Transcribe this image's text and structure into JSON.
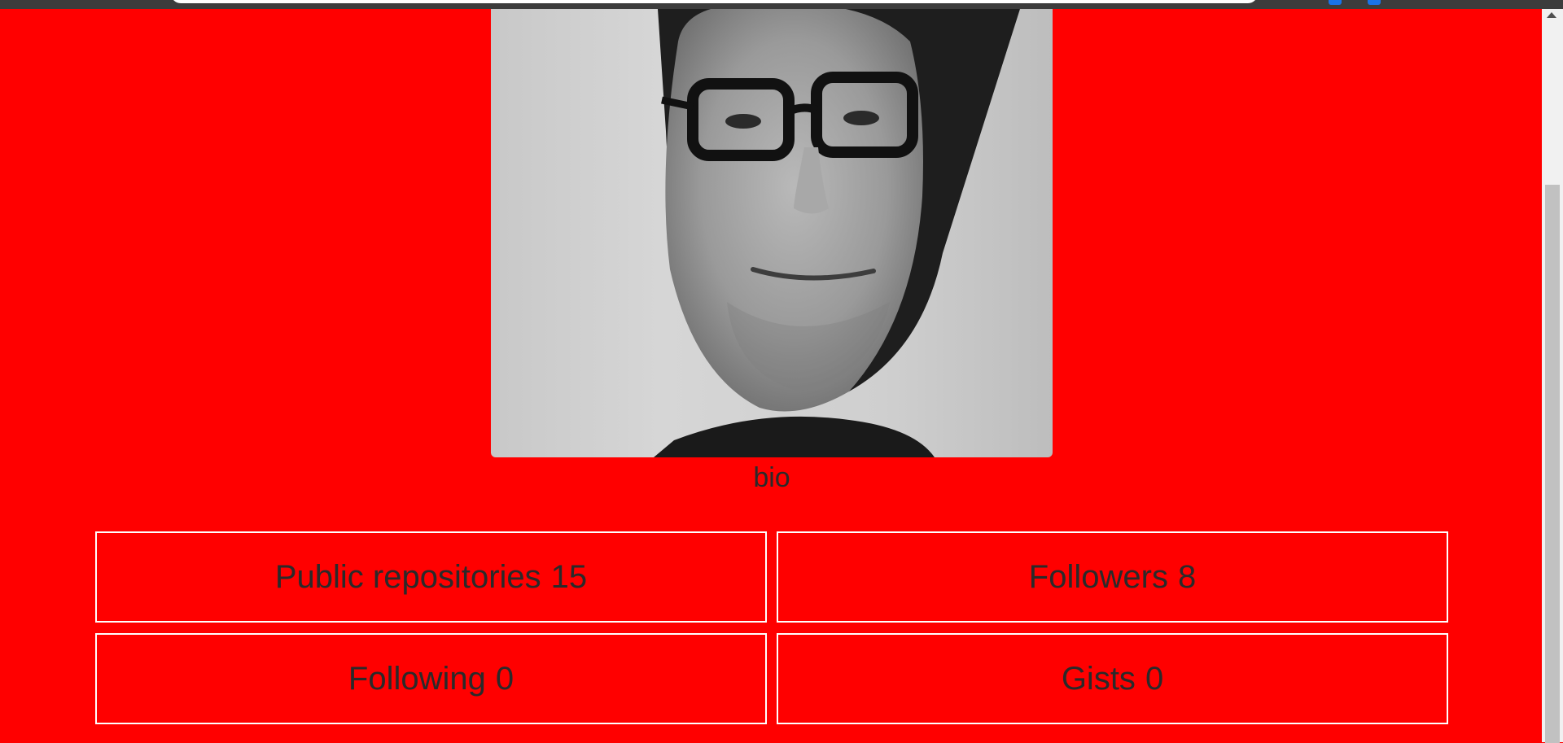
{
  "profile": {
    "bio": "bio"
  },
  "stats": {
    "public_repositories": {
      "label": "Public repositories",
      "value": "15"
    },
    "followers": {
      "label": "Followers",
      "value": "8"
    },
    "following": {
      "label": "Following",
      "value": "0"
    },
    "gists": {
      "label": "Gists",
      "value": "0"
    }
  },
  "colors": {
    "page_background": "#ff0000",
    "text": "#2a2a2a",
    "card_border": "#ffffff"
  }
}
